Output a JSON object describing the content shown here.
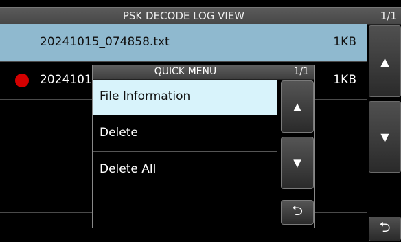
{
  "window": {
    "title": "PSK DECODE LOG VIEW",
    "page": "1/1"
  },
  "files": [
    {
      "name": "20241015_074858.txt",
      "size": "1KB",
      "selected": true,
      "recording": false
    },
    {
      "name": "2024101",
      "size": "1KB",
      "selected": false,
      "recording": true
    }
  ],
  "sidebar": {
    "up_icon": "▲",
    "down_icon": "▼",
    "back_icon": "⮌"
  },
  "quick_menu": {
    "title": "QUICK MENU",
    "page": "1/1",
    "items": [
      {
        "label": "File Information"
      },
      {
        "label": "Delete"
      },
      {
        "label": "Delete All"
      }
    ],
    "up_icon": "▲",
    "down_icon": "▼",
    "back_icon": "⮌"
  },
  "colors": {
    "selected_row": "#8fb9cf",
    "selected_menu": "#d8f3fb",
    "record_dot": "#d40000"
  }
}
